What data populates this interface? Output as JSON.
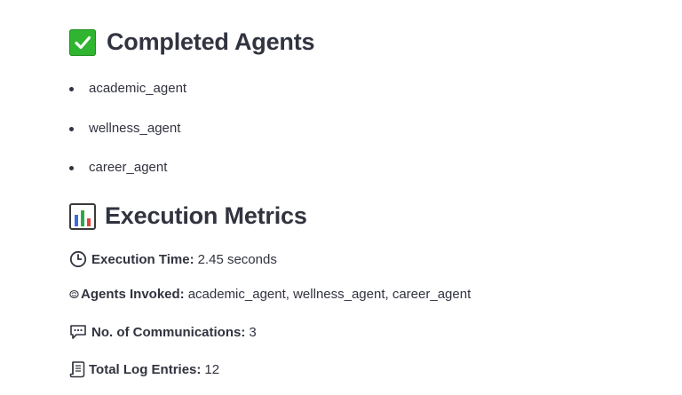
{
  "sections": {
    "completed": {
      "icon": "check-mark-button-icon",
      "title": "Completed Agents",
      "agents": [
        "academic_agent",
        "wellness_agent",
        "career_agent"
      ]
    },
    "metrics": {
      "icon": "bar-chart-icon",
      "title": "Execution Metrics",
      "items": [
        {
          "icon": "clock-icon",
          "label": "Execution Time:",
          "value": "2.45 seconds"
        },
        {
          "icon": "brain-icon",
          "label": "Agents Invoked:",
          "value": "academic_agent, wellness_agent, career_agent"
        },
        {
          "icon": "speech-balloon-icon",
          "label": "No. of Communications:",
          "value": "3"
        },
        {
          "icon": "scroll-icon",
          "label": "Total Log Entries:",
          "value": "12"
        }
      ]
    }
  },
  "colors": {
    "text": "#31333f",
    "check_green": "#2fb52f"
  }
}
